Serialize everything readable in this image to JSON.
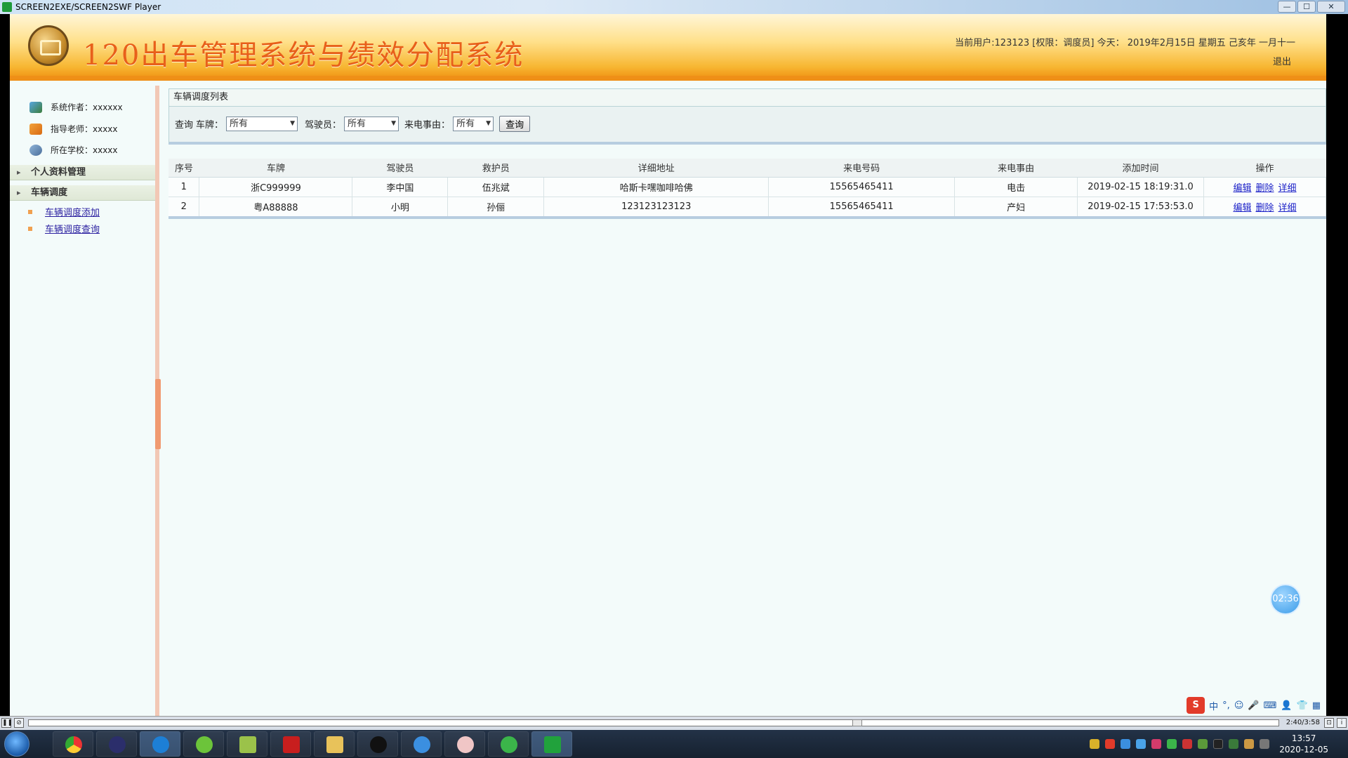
{
  "player": {
    "title": "SCREEN2EXE/SCREEN2SWF Player",
    "minimize": "—",
    "maximize": "☐",
    "close": "✕",
    "time_readout": "2:40/3:58",
    "progress_fraction": 0.664
  },
  "header": {
    "system_title": "120出车管理系统与绩效分配系统",
    "user_info": "当前用户:123123 [权限：调度员] 今天： 2019年2月15日 星期五 己亥年 一月十一",
    "logout": "退出"
  },
  "sidebar": {
    "info": [
      {
        "label": "系统作者：xxxxxx",
        "icon": "author-icon"
      },
      {
        "label": "指导老师：xxxxx",
        "icon": "teacher-icon"
      },
      {
        "label": "所在学校：xxxxx",
        "icon": "school-icon"
      }
    ],
    "menus": [
      {
        "label": "个人资料管理"
      },
      {
        "label": "车辆调度"
      }
    ],
    "sub_items": [
      {
        "label": "车辆调度添加"
      },
      {
        "label": "车辆调度查询"
      }
    ]
  },
  "main": {
    "list_title": "车辆调度列表",
    "query": {
      "prefix": "查询",
      "plate_label": "车牌：",
      "plate_value": "所有",
      "driver_label": "驾驶员：",
      "driver_value": "所有",
      "reason_label": "来电事由：",
      "reason_value": "所有",
      "button": "查询"
    },
    "table": {
      "headers": [
        "序号",
        "车牌",
        "驾驶员",
        "救护员",
        "详细地址",
        "来电号码",
        "来电事由",
        "添加时间",
        "操作"
      ],
      "rows": [
        {
          "no": "1",
          "plate": "浙C999999",
          "driver": "李中国",
          "medic": "伍兆斌",
          "address": "哈斯卡嘿咖啡哈佛",
          "phone": "15565465411",
          "reason": "电击",
          "time": "2019-02-15 18:19:31.0",
          "edit": "编辑",
          "delete": "删除",
          "detail": "详细"
        },
        {
          "no": "2",
          "plate": "粤A88888",
          "driver": "小明",
          "medic": "孙俪",
          "address": "123123123123",
          "phone": "15565465411",
          "reason": "产妇",
          "time": "2019-02-15 17:53:53.0",
          "edit": "编辑",
          "delete": "删除",
          "detail": "详细"
        }
      ]
    }
  },
  "overlay": {
    "timer": "02:36",
    "ime_lang": "中"
  },
  "taskbar": {
    "clock_time": "13:57",
    "clock_date": "2020-12-05"
  }
}
